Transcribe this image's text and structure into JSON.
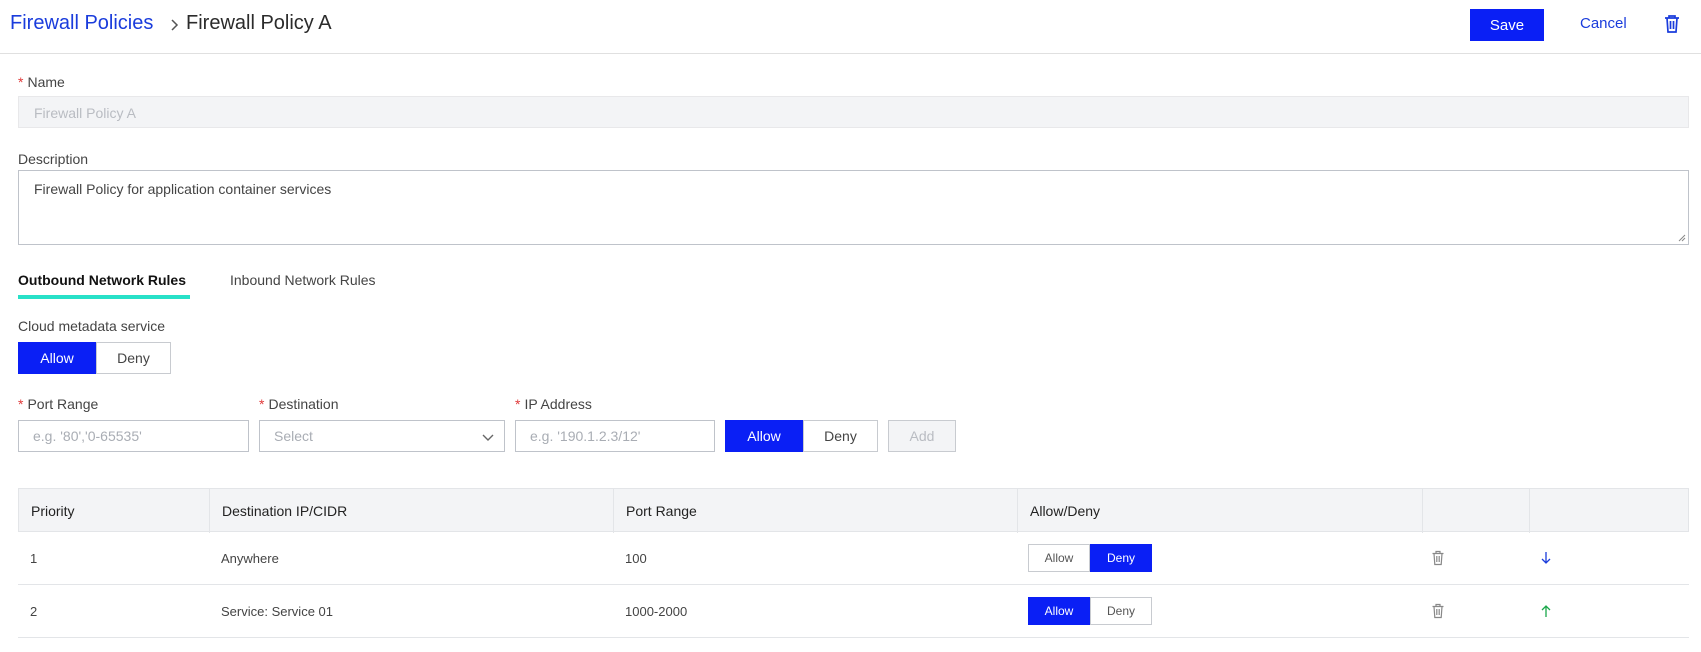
{
  "header": {
    "breadcrumb_parent": "Firewall Policies",
    "breadcrumb_current": "Firewall Policy A",
    "save_label": "Save",
    "cancel_label": "Cancel"
  },
  "form": {
    "name_label": "Name",
    "name_value": "Firewall Policy A",
    "description_label": "Description",
    "description_value": "Firewall Policy for application container services"
  },
  "tabs": [
    {
      "label": "Outbound Network Rules",
      "active": true
    },
    {
      "label": "Inbound Network Rules",
      "active": false
    }
  ],
  "metadata": {
    "label": "Cloud metadata service",
    "allow_label": "Allow",
    "deny_label": "Deny",
    "selected": "Allow"
  },
  "rule_form": {
    "port_range_label": "Port Range",
    "port_range_placeholder": "e.g. '80','0-65535'",
    "destination_label": "Destination",
    "destination_value": "Select",
    "ip_label": "IP Address",
    "ip_placeholder": "e.g. '190.1.2.3/12'",
    "allow_label": "Allow",
    "deny_label": "Deny",
    "add_label": "Add"
  },
  "table": {
    "columns": [
      "Priority",
      "Destination IP/CIDR",
      "Port Range",
      "Allow/Deny",
      "",
      ""
    ],
    "rows": [
      {
        "priority": "1",
        "destination": "Anywhere",
        "port_range": "100",
        "allow_label": "Allow",
        "deny_label": "Deny",
        "selected": "Deny",
        "move": "down"
      },
      {
        "priority": "2",
        "destination": "Service: Service 01",
        "port_range": "1000-2000",
        "allow_label": "Allow",
        "deny_label": "Deny",
        "selected": "Allow",
        "move": "up"
      }
    ]
  },
  "colors": {
    "accent": "#0a1ff5",
    "link": "#1a3cdc",
    "tab_underline": "#28e1c8",
    "required": "#e03a3a"
  }
}
